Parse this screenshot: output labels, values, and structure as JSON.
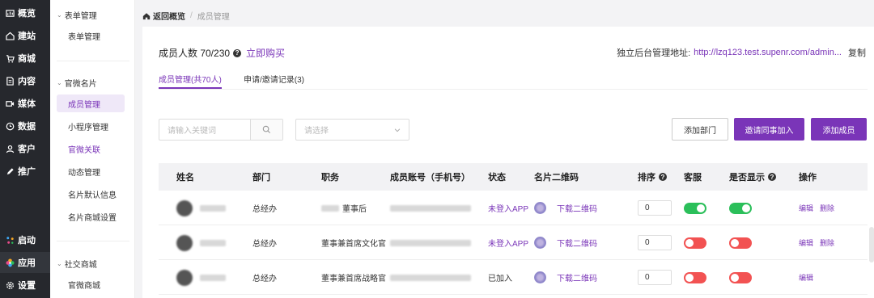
{
  "rail": {
    "items": [
      {
        "label": "概览",
        "icon": "chart-icon"
      },
      {
        "label": "建站",
        "icon": "home-icon"
      },
      {
        "label": "商城",
        "icon": "cart-icon"
      },
      {
        "label": "内容",
        "icon": "document-icon"
      },
      {
        "label": "媒体",
        "icon": "video-icon"
      },
      {
        "label": "数据",
        "icon": "clock-icon"
      },
      {
        "label": "客户",
        "icon": "user-icon"
      },
      {
        "label": "推广",
        "icon": "edit-icon"
      }
    ],
    "bottom": [
      {
        "label": "启动",
        "icon": "dots-icon"
      },
      {
        "label": "应用",
        "icon": "flower-icon"
      },
      {
        "label": "设置",
        "icon": "gear-icon"
      }
    ]
  },
  "submenu": {
    "group1": "表单管理",
    "group1_items": [
      "表单管理"
    ],
    "group2": "官微名片",
    "group2_items": [
      "成员管理",
      "小程序管理",
      "官微关联",
      "动态管理",
      "名片默认信息",
      "名片商城设置"
    ],
    "group3": "社交商城",
    "group3_items": [
      "官微商城"
    ]
  },
  "breadcrumb": {
    "home": "返回概览",
    "separator": "/",
    "current": "成员管理"
  },
  "summary": {
    "count_label": "成员人数 70/230",
    "buy": "立即购买"
  },
  "admin": {
    "label": "独立后台管理地址:",
    "url": "http://lzq123.test.supenr.com/admin...",
    "copy": "复制"
  },
  "tabs": [
    {
      "label": "成员管理(共70人)"
    },
    {
      "label": "申请/邀请记录(3)"
    }
  ],
  "search": {
    "placeholder": "请输入关键词"
  },
  "select": {
    "placeholder": "请选择"
  },
  "buttons": {
    "add_dept": "添加部门",
    "invite": "邀请同事加入",
    "add_member": "添加成员"
  },
  "table": {
    "headers": [
      "姓名",
      "部门",
      "职务",
      "成员账号（手机号）",
      "状态",
      "名片二维码",
      "排序",
      "客服",
      "是否显示",
      "操作"
    ],
    "rows": [
      {
        "dept": "总经办",
        "title": "董事后",
        "status": "未登入APP",
        "qr_link": "下载二维码",
        "sort": "0",
        "service": "on",
        "display": "on",
        "ops": [
          "编辑",
          "删除"
        ]
      },
      {
        "dept": "总经办",
        "title": "董事兼首席文化官",
        "status": "未登入APP",
        "qr_link": "下载二维码",
        "sort": "0",
        "service": "off",
        "display": "off",
        "ops": [
          "编辑",
          "删除"
        ]
      },
      {
        "dept": "总经办",
        "title": "董事兼首席战略官",
        "status": "已加入",
        "qr_link": "下载二维码",
        "sort": "0",
        "service": "off",
        "display": "off",
        "ops": [
          "编辑"
        ]
      }
    ]
  },
  "colors": {
    "accent": "#7a35b8",
    "toggle_on": "#2bbf5a",
    "toggle_off": "#f25252",
    "rail_bg": "#26282d"
  }
}
